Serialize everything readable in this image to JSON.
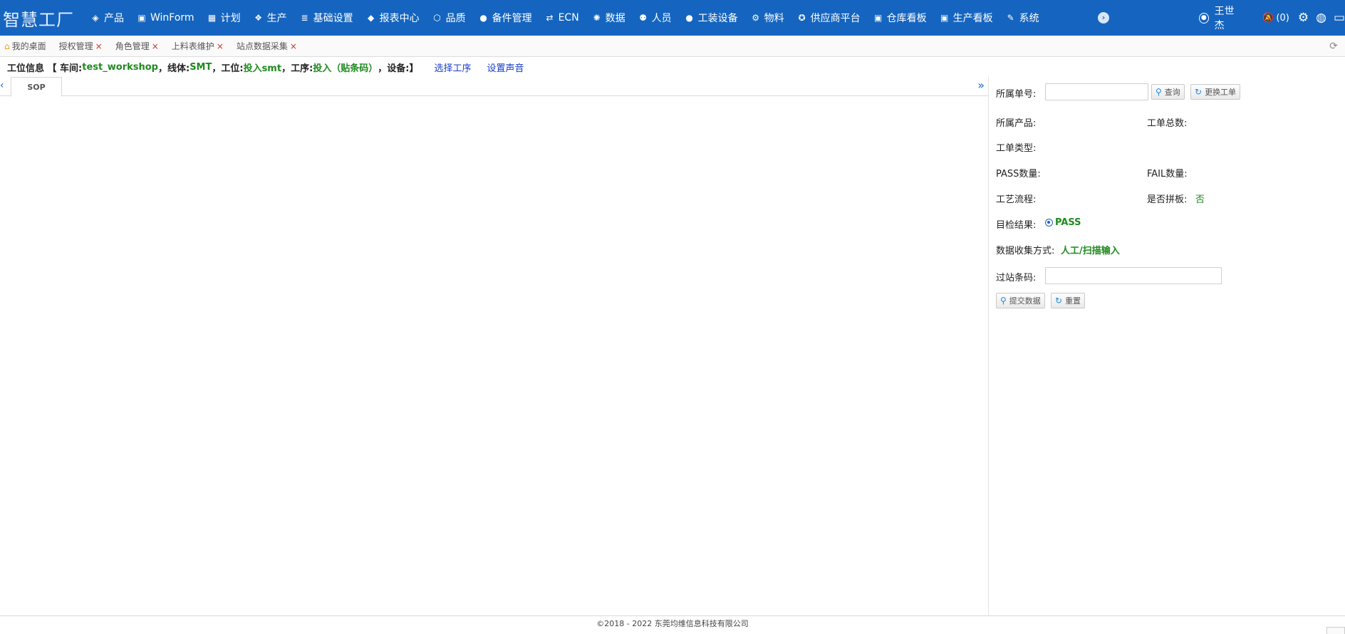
{
  "app": {
    "brand": "智慧工厂"
  },
  "nav": {
    "items": [
      {
        "icon": "cube-icon",
        "glyph": "◈",
        "label": "产品"
      },
      {
        "icon": "window-icon",
        "glyph": "▣",
        "label": "WinForm"
      },
      {
        "icon": "calendar-icon",
        "glyph": "▦",
        "label": "计划"
      },
      {
        "icon": "cubes-icon",
        "glyph": "❖",
        "label": "生产"
      },
      {
        "icon": "database-icon",
        "glyph": "≣",
        "label": "基础设置"
      },
      {
        "icon": "layers-icon",
        "glyph": "◆",
        "label": "报表中心"
      },
      {
        "icon": "shield-icon",
        "glyph": "⬡",
        "label": "品质"
      },
      {
        "icon": "wrench-circle-icon",
        "glyph": "●",
        "label": "备件管理"
      },
      {
        "icon": "exchange-icon",
        "glyph": "⇄",
        "label": "ECN"
      },
      {
        "icon": "dots-ring-icon",
        "glyph": "✺",
        "label": "数据"
      },
      {
        "icon": "people-icon",
        "glyph": "⚉",
        "label": "人员"
      },
      {
        "icon": "tool-circle-icon",
        "glyph": "●",
        "label": "工装设备"
      },
      {
        "icon": "boxes-icon",
        "glyph": "⚙",
        "label": "物料"
      },
      {
        "icon": "award-icon",
        "glyph": "✪",
        "label": "供应商平台"
      },
      {
        "icon": "board-icon",
        "glyph": "▣",
        "label": "仓库看板"
      },
      {
        "icon": "board-icon",
        "glyph": "▣",
        "label": "生产看板"
      },
      {
        "icon": "wrench-icon",
        "glyph": "✎",
        "label": "系统"
      }
    ],
    "more_glyph": "›",
    "user_name": "王世杰",
    "notify_count": "(0)"
  },
  "tabs": [
    {
      "label": "我的桌面",
      "closable": false
    },
    {
      "label": "授权管理",
      "closable": true
    },
    {
      "label": "角色管理",
      "closable": true
    },
    {
      "label": "上料表维护",
      "closable": true
    },
    {
      "label": "站点数据采集",
      "closable": true
    }
  ],
  "info": {
    "prefix": "工位信息 【 车间:",
    "workshop": "test_workshop",
    "line_label": "，线体:",
    "line": "SMT",
    "station_label": "，工位:",
    "station": "投入smt",
    "process_label": "，工序:",
    "process": "投入（贴条码）",
    "device_label": "，设备:",
    "suffix": "】",
    "select_process": "选择工序",
    "set_sound": "设置声音"
  },
  "sop": {
    "tab_label": "SOP"
  },
  "form": {
    "order_no_label": "所属单号:",
    "order_no_value": "",
    "query_btn": "查询",
    "change_order_btn": "更换工单",
    "product_label": "所属产品:",
    "order_total_label": "工单总数:",
    "order_type_label": "工单类型:",
    "pass_qty_label": "PASS数量:",
    "fail_qty_label": "FAIL数量:",
    "process_flow_label": "工艺流程:",
    "panel_label": "是否拼板:",
    "panel_value": "否",
    "visual_result_label": "目检结果:",
    "visual_result_value": "PASS",
    "collect_mode_label": "数据收集方式:",
    "collect_mode_value": "人工/扫描输入",
    "barcode_label": "过站条码:",
    "barcode_value": "",
    "submit_btn": "提交数据",
    "reset_btn": "重置"
  },
  "footer": {
    "copyright": "©2018 - 2022 东莞均维信息科技有限公司"
  }
}
